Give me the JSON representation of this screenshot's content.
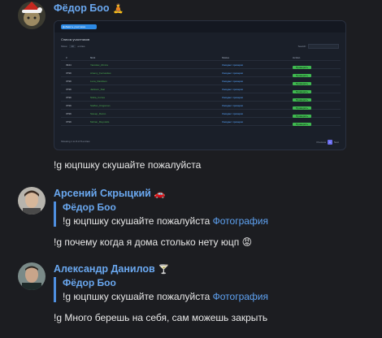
{
  "messages": [
    {
      "author": "Фёдор Боо",
      "author_emoji": "🧘",
      "attachment": {
        "button": "Добавить участника",
        "title": "Список участников",
        "show_label": "Show",
        "show_value": "10",
        "entries_label": "entries",
        "search_label": "Search:",
        "headers": [
          "#",
          "Nick",
          "Status",
          "Action"
        ],
        "rows": [
          {
            "id": "3944",
            "nick": "Yaroslav_Zin1ov",
            "status": "Ожидает проверки",
            "action": "Проверить"
          },
          {
            "id": "3799",
            "nick": "Artemy_Fernandes",
            "status": "Ожидает проверки",
            "action": "Проверить"
          },
          {
            "id": "3799",
            "nick": "Luna_Davidson",
            "status": "Ожидает проверки",
            "action": "Проверить"
          },
          {
            "id": "3799",
            "nick": "Jackson_Stat",
            "status": "Ожидает проверки",
            "action": "Проверить"
          },
          {
            "id": "3799",
            "nick": "Nikita_Cortes",
            "status": "Ожидает проверки",
            "action": "Проверить"
          },
          {
            "id": "3799",
            "nick": "Steffan_Kingsman",
            "status": "Ожидает проверки",
            "action": "Проверить"
          },
          {
            "id": "3799",
            "nick": "Sweep_Rocco",
            "status": "Ожидает проверки",
            "action": "Проверить"
          },
          {
            "id": "3799",
            "nick": "Mohan_Reynolds",
            "status": "Ожидает проверки",
            "action": "Проверить"
          }
        ],
        "footer": "Showing 1 to 8 of 8 entries",
        "pager_prev": "Previous",
        "pager_current": "1",
        "pager_next": "Next"
      },
      "text": "!g юцпшку скушайте пожалуйста"
    },
    {
      "author": "Арсений Скрыцкий",
      "author_emoji": "🚗",
      "quote_author": "Фёдор Боо",
      "quote_text": "!g юцпшку скушайте пожалуйста",
      "quote_link": "Фотография",
      "text": "!g почему когда я дома столько нету юцп",
      "text_emoji": "😡"
    },
    {
      "author": "Александр Данилов",
      "author_emoji": "🍸",
      "quote_author": "Фёдор Боо",
      "quote_text": "!g юцпшку скушайте пожалуйста",
      "quote_link": "Фотография",
      "text": "!g Много берешь на себя, сам можешь закрыть"
    }
  ]
}
